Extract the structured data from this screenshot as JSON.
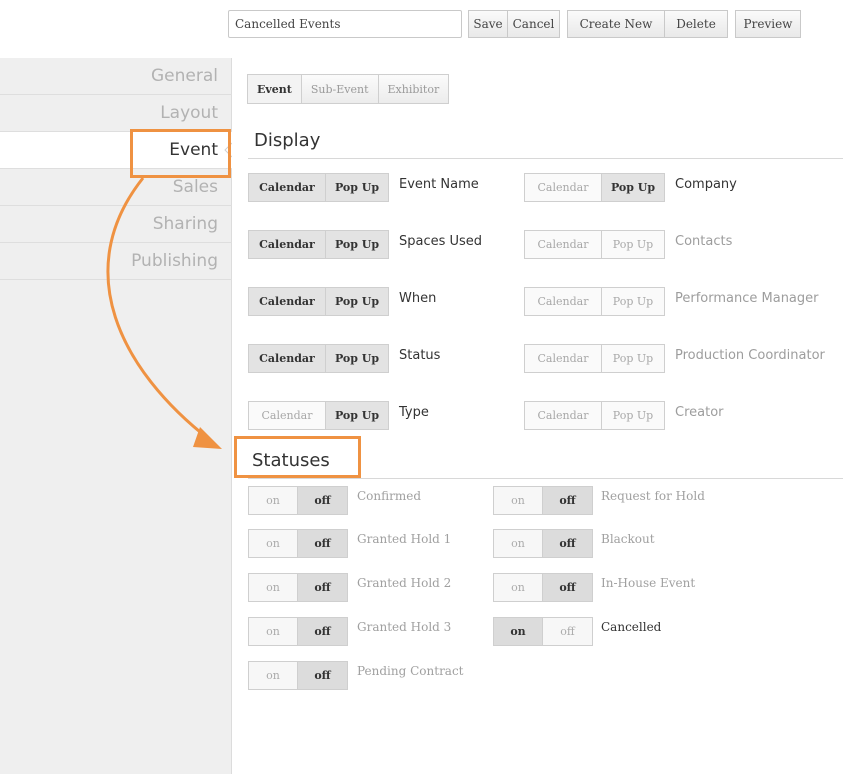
{
  "toolbar": {
    "name_value": "Cancelled Events",
    "save_label": "Save",
    "cancel_label": "Cancel",
    "create_new_label": "Create New",
    "delete_label": "Delete",
    "preview_label": "Preview"
  },
  "sidebar": {
    "items": [
      {
        "label": "General"
      },
      {
        "label": "Layout"
      },
      {
        "label": "Event"
      },
      {
        "label": "Sales"
      },
      {
        "label": "Sharing"
      },
      {
        "label": "Publishing"
      }
    ],
    "active": "Event"
  },
  "subtabs": [
    {
      "label": "Event"
    },
    {
      "label": "Sub-Event"
    },
    {
      "label": "Exhibitor"
    }
  ],
  "display": {
    "title": "Display",
    "calendar_label": "Calendar",
    "popup_label": "Pop Up",
    "left": [
      {
        "field": "Event Name",
        "calendar": true,
        "popup": true
      },
      {
        "field": "Spaces Used",
        "calendar": true,
        "popup": true
      },
      {
        "field": "When",
        "calendar": true,
        "popup": true
      },
      {
        "field": "Status",
        "calendar": true,
        "popup": true
      },
      {
        "field": "Type",
        "calendar": false,
        "popup": true
      }
    ],
    "right": [
      {
        "field": "Company",
        "calendar": false,
        "popup": true
      },
      {
        "field": "Contacts",
        "calendar": false,
        "popup": false
      },
      {
        "field": "Performance Manager",
        "calendar": false,
        "popup": false
      },
      {
        "field": "Production Coordinator",
        "calendar": false,
        "popup": false
      },
      {
        "field": "Creator",
        "calendar": false,
        "popup": false
      }
    ]
  },
  "statuses": {
    "title": "Statuses",
    "on_label": "on",
    "off_label": "off",
    "left": [
      {
        "label": "Confirmed",
        "state": "off"
      },
      {
        "label": "Granted Hold 1",
        "state": "off"
      },
      {
        "label": "Granted Hold 2",
        "state": "off"
      },
      {
        "label": "Granted Hold 3",
        "state": "off"
      },
      {
        "label": "Pending Contract",
        "state": "off"
      }
    ],
    "right": [
      {
        "label": "Request for Hold",
        "state": "off"
      },
      {
        "label": "Blackout",
        "state": "off"
      },
      {
        "label": "In-House Event",
        "state": "off"
      },
      {
        "label": "Cancelled",
        "state": "on"
      }
    ]
  },
  "colors": {
    "highlight": "#ef9242",
    "sidebar_bg": "#efefef"
  }
}
